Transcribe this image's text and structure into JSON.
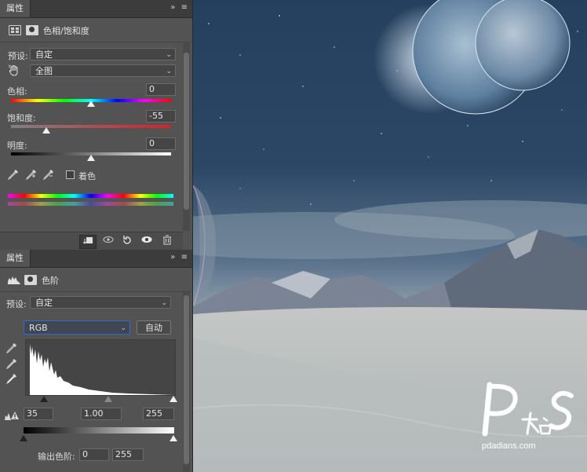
{
  "panel1": {
    "tab_label": "属性",
    "collapse_glyph": "»",
    "menu_glyph": "≡",
    "adjustment_title": "色相/饱和度",
    "preset_label": "预设:",
    "preset_value": "自定",
    "channel_value": "全图",
    "hue": {
      "label": "色相:",
      "value": "0"
    },
    "saturation": {
      "label": "饱和度:",
      "value": "-55"
    },
    "lightness": {
      "label": "明度:",
      "value": "0"
    },
    "colorize_label": "着色"
  },
  "panel2": {
    "tab_label": "属性",
    "collapse_glyph": "»",
    "menu_glyph": "≡",
    "adjustment_title": "色阶",
    "preset_label": "预设:",
    "preset_value": "自定",
    "channel_value": "RGB",
    "auto_label": "自动",
    "input_black": "35",
    "input_gamma": "1.00",
    "input_white": "255",
    "output_label": "输出色阶:",
    "output_black": "0",
    "output_white": "255"
  },
  "watermark": {
    "site": "pdadians.com"
  },
  "colors": {
    "panel_bg": "#535353",
    "field_bg": "#454545",
    "accent": "#2f6bd6"
  },
  "icons": [
    "adjustment-layer-icon",
    "mask-icon",
    "hand-icon",
    "eyedropper-icon",
    "eyedropper-plus-icon",
    "eyedropper-minus-icon",
    "clip-icon",
    "view-previous-icon",
    "reset-icon",
    "visibility-icon",
    "trash-icon",
    "levels-icon",
    "warning-icon"
  ]
}
